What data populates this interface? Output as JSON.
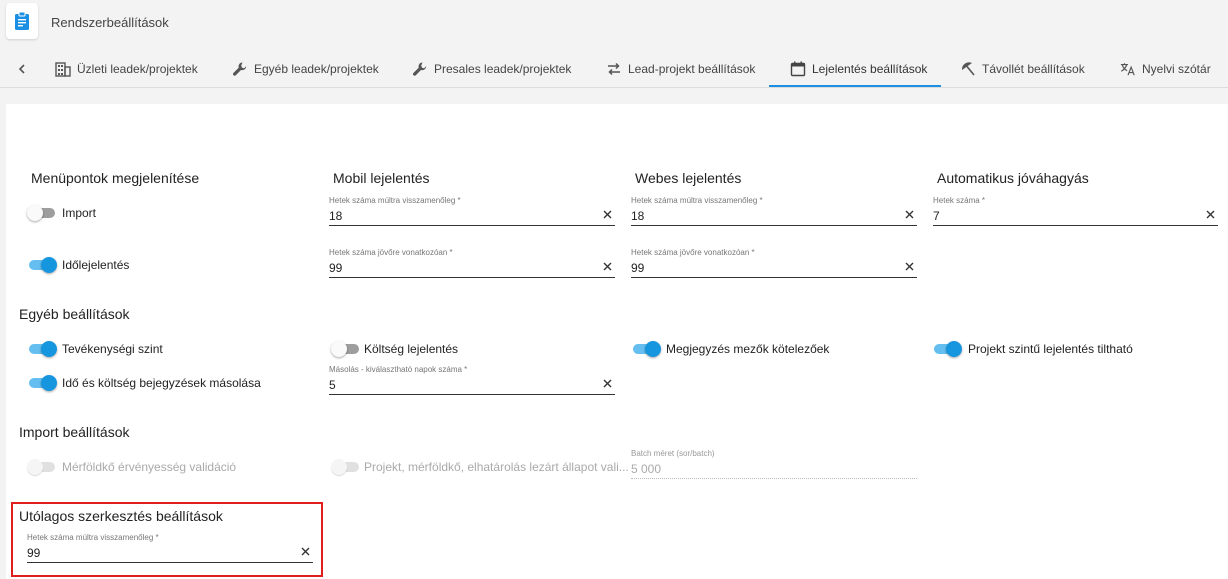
{
  "header": {
    "title": "Rendszerbeállítások",
    "icon": "clipboard-icon"
  },
  "tabs": [
    {
      "label": "Üzleti leadek/projektek",
      "icon": "building-icon"
    },
    {
      "label": "Egyéb leadek/projektek",
      "icon": "wrench-icon"
    },
    {
      "label": "Presales leadek/projektek",
      "icon": "wrench-icon"
    },
    {
      "label": "Lead-projekt beállítások",
      "icon": "swap-icon"
    },
    {
      "label": "Lejelentés beállítások",
      "icon": "calendar-icon",
      "active": true
    },
    {
      "label": "Távollét beállítások",
      "icon": "beach-icon"
    },
    {
      "label": "Nyelvi szótár",
      "icon": "translate-icon"
    }
  ],
  "sections": {
    "menu": {
      "title": "Menüpontok megjelenítése",
      "toggles": [
        {
          "label": "Import",
          "on": false
        },
        {
          "label": "Időlejelentés",
          "on": true
        }
      ]
    },
    "mobile": {
      "title": "Mobil lejelentés",
      "fields": [
        {
          "label": "Hetek száma múltra visszamenőleg *",
          "value": "18"
        },
        {
          "label": "Hetek száma jövőre vonatkozóan *",
          "value": "99"
        }
      ]
    },
    "web": {
      "title": "Webes lejelentés",
      "fields": [
        {
          "label": "Hetek száma múltra visszamenőleg *",
          "value": "18"
        },
        {
          "label": "Hetek száma jövőre vonatkozóan *",
          "value": "99"
        }
      ]
    },
    "auto": {
      "title": "Automatikus jóváhagyás",
      "fields": [
        {
          "label": "Hetek száma *",
          "value": "7"
        }
      ]
    },
    "other": {
      "title": "Egyéb beállítások",
      "toggles": [
        {
          "label": "Tevékenységi szint",
          "on": true
        },
        {
          "label": "Költség lejelentés",
          "on": false
        },
        {
          "label": "Megjegyzés mezők kötelezőek",
          "on": true
        },
        {
          "label": "Projekt szintű lejelentés tiltható",
          "on": true
        },
        {
          "label": "Idő és költség bejegyzések másolása",
          "on": true
        }
      ],
      "fields": [
        {
          "label": "Másolás - kiválasztható napok száma *",
          "value": "5"
        }
      ]
    },
    "import": {
      "title": "Import beállítások",
      "toggles": [
        {
          "label": "Mérföldkő érvényesség validáció",
          "on": false,
          "disabled": true
        },
        {
          "label": "Projekt, mérföldkő, elhatárolás lezárt állapot vali...",
          "on": false,
          "disabled": true
        }
      ],
      "fields": [
        {
          "label": "Batch méret (sor/batch)",
          "value": "5 000",
          "disabled": true
        }
      ]
    },
    "post": {
      "title": "Utólagos szerkesztés beállítások",
      "fields": [
        {
          "label": "Hetek száma múltra visszamenőleg *",
          "value": "99"
        }
      ]
    }
  },
  "colors": {
    "accent": "#1a8fe3",
    "highlight": "#e01e1e"
  }
}
